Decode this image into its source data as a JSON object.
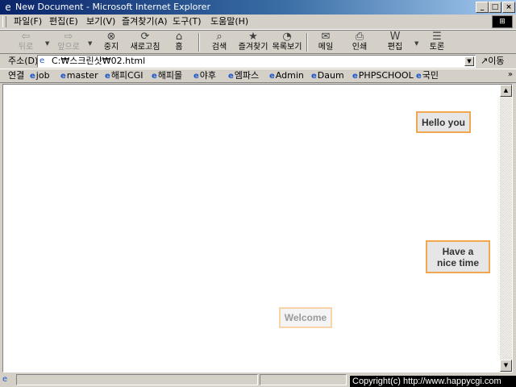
{
  "window": {
    "title": "New Document - Microsoft Internet Explorer",
    "min_glyph": "_",
    "max_glyph": "□",
    "close_glyph": "×"
  },
  "menu": [
    "파일(F)",
    "편집(E)",
    "보기(V)",
    "즐겨찾기(A)",
    "도구(T)",
    "도움말(H)"
  ],
  "toolbar": {
    "back": "뒤로",
    "forward": "앞으로",
    "stop": "중지",
    "refresh": "새로고침",
    "home": "홈",
    "search": "검색",
    "favorites": "즐겨찾기",
    "history": "목록보기",
    "mail": "메일",
    "print": "인쇄",
    "edit": "편집",
    "discuss": "토론"
  },
  "address": {
    "label": "주소(D)",
    "value": "C:₩스크린샷₩02.html",
    "go": "이동"
  },
  "links": {
    "label": "연결",
    "items": [
      "job",
      "master",
      "해피CGI",
      "해피몰",
      "야후",
      "엠파스",
      "Admin",
      "Daum",
      "PHPSCHOOL",
      "국민"
    ]
  },
  "content": {
    "box1": "Hello you",
    "box2_line1": "Have a",
    "box2_line2": "nice time",
    "box3": "Welcome"
  },
  "footer": {
    "copyright": "Copyright(c) http://www.happycgi.com"
  },
  "colors": {
    "titlebar_start": "#0a246a",
    "box_border": "#f0a850",
    "box_bg": "#e6e6e6"
  }
}
